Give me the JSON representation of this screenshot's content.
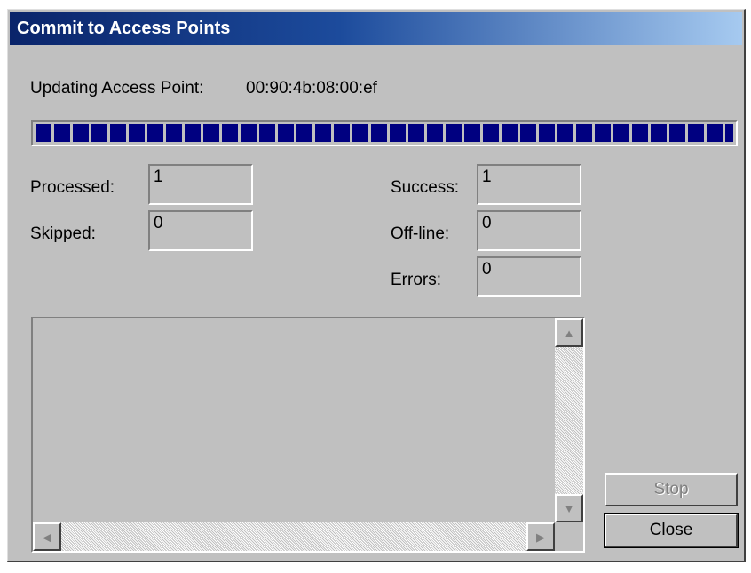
{
  "window": {
    "title": "Commit to Access Points"
  },
  "status": {
    "label": "Updating Access Point:",
    "value": "00:90:4b:08:00:ef"
  },
  "progress": {
    "fraction": 1.0
  },
  "counters": {
    "processed_label": "Processed:",
    "processed_value": "1",
    "skipped_label": "Skipped:",
    "skipped_value": "0",
    "success_label": "Success:",
    "success_value": "1",
    "offline_label": "Off-line:",
    "offline_value": "0",
    "errors_label": "Errors:",
    "errors_value": "0"
  },
  "log": {
    "lines": []
  },
  "buttons": {
    "stop_label": "Stop",
    "stop_enabled": false,
    "close_label": "Close"
  },
  "icons": {
    "scroll_up": "scroll-up-arrow-icon",
    "scroll_down": "scroll-down-arrow-icon",
    "scroll_left": "scroll-left-arrow-icon",
    "scroll_right": "scroll-right-arrow-icon"
  },
  "colors": {
    "title_start": "#0a246a",
    "title_end": "#a6caf0",
    "progress": "#000080",
    "face": "#c0c0c0"
  }
}
